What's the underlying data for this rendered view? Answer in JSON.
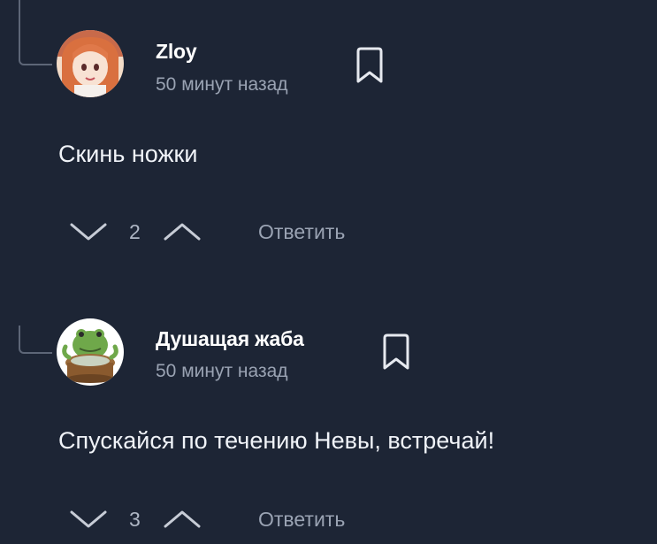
{
  "comments": [
    {
      "author": "Zloy",
      "time": "50 минут назад",
      "text": "Скинь ножки",
      "score": "2",
      "reply_label": "Ответить",
      "avatar": "anime-girl-avatar"
    },
    {
      "author": "Душащая жаба",
      "time": "50 минут назад",
      "text": "Спускайся по течению Невы, встречай!",
      "score": "3",
      "reply_label": "Ответить",
      "avatar": "frog-avatar"
    }
  ],
  "colors": {
    "background": "#1d2535",
    "text": "#f0f3f8",
    "muted": "#9aa3b3",
    "icon": "#e6e9ef",
    "thread_line": "#5d6677"
  },
  "icons": [
    "bookmark-icon",
    "chevron-down-icon",
    "chevron-up-icon"
  ]
}
